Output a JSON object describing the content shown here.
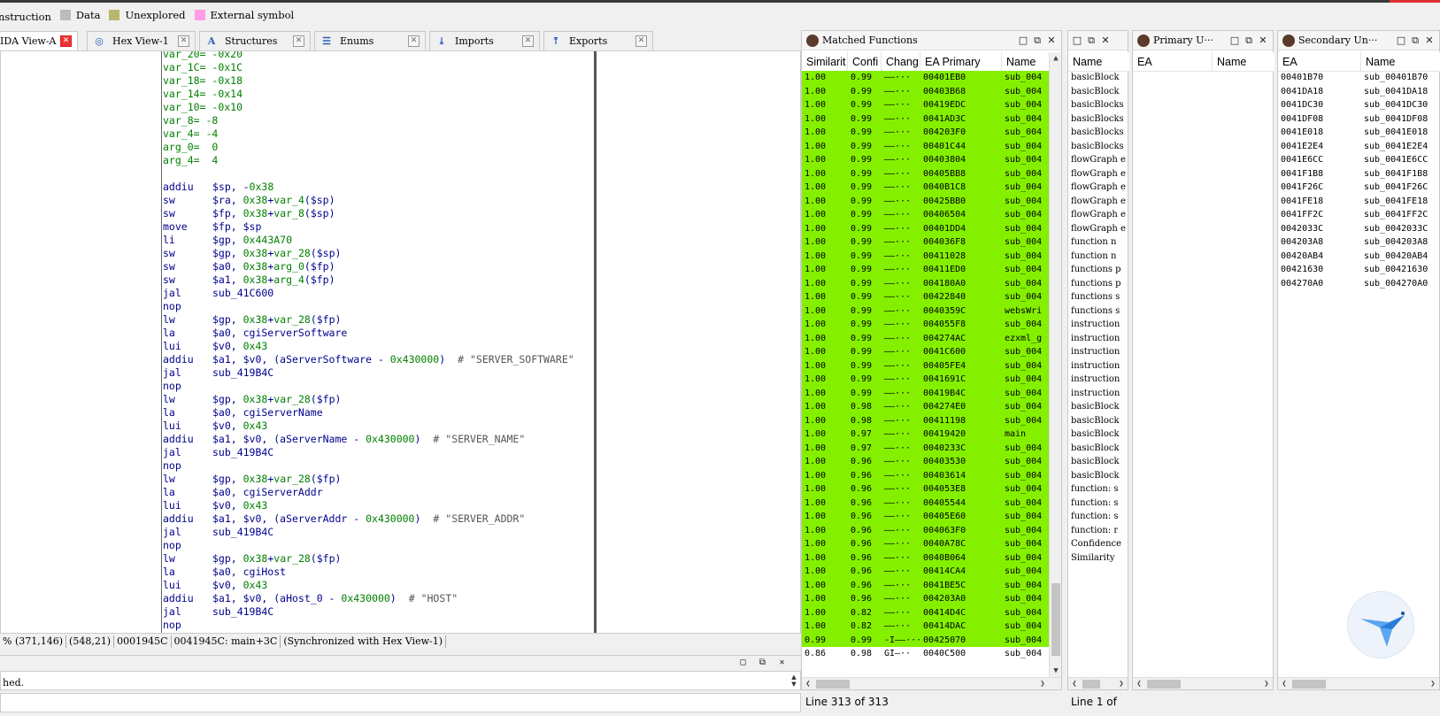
{
  "top_legend": [
    {
      "label": "nstruction",
      "color": ""
    },
    {
      "label": "Data",
      "color": "#bcbcbc"
    },
    {
      "label": "Unexplored",
      "color": "#b9b66e"
    },
    {
      "label": "External symbol",
      "color": "#ff9ce6"
    }
  ],
  "tabs": [
    {
      "label": "IDA View-A",
      "icon": "ida-view-icon",
      "active": true
    },
    {
      "label": "Hex View-1",
      "icon": "hex-view-icon",
      "active": false
    },
    {
      "label": "Structures",
      "icon": "structures-icon",
      "active": false
    },
    {
      "label": "Enums",
      "icon": "enums-icon",
      "active": false
    },
    {
      "label": "Imports",
      "icon": "imports-icon",
      "active": false
    },
    {
      "label": "Exports",
      "icon": "exports-icon",
      "active": false
    }
  ],
  "disasm_lines": [
    {
      "t": "var",
      "name": "var_20",
      "val": "-0x20"
    },
    {
      "t": "var",
      "name": "var_1C",
      "val": "-0x1C"
    },
    {
      "t": "var",
      "name": "var_18",
      "val": "-0x18"
    },
    {
      "t": "var",
      "name": "var_14",
      "val": "-0x14"
    },
    {
      "t": "var",
      "name": "var_10",
      "val": "-0x10"
    },
    {
      "t": "var",
      "name": "var_8",
      "val": "-8"
    },
    {
      "t": "var",
      "name": "var_4",
      "val": "-4"
    },
    {
      "t": "var",
      "name": "arg_0",
      "val": " 0"
    },
    {
      "t": "var",
      "name": "arg_4",
      "val": " 4"
    },
    {
      "t": "blank"
    },
    {
      "t": "ins",
      "m": "addiu",
      "ops": "$sp, -0x38"
    },
    {
      "t": "ins",
      "m": "sw",
      "ops": "$ra, 0x38+var_4($sp)"
    },
    {
      "t": "ins",
      "m": "sw",
      "ops": "$fp, 0x38+var_8($sp)"
    },
    {
      "t": "ins",
      "m": "move",
      "ops": "$fp, $sp"
    },
    {
      "t": "ins",
      "m": "li",
      "ops": "$gp, 0x443A70"
    },
    {
      "t": "ins",
      "m": "sw",
      "ops": "$gp, 0x38+var_28($sp)"
    },
    {
      "t": "ins",
      "m": "sw",
      "ops": "$a0, 0x38+arg_0($fp)"
    },
    {
      "t": "ins",
      "m": "sw",
      "ops": "$a1, 0x38+arg_4($fp)"
    },
    {
      "t": "ins",
      "m": "jal",
      "ops": "sub_41C600"
    },
    {
      "t": "ins",
      "m": "nop",
      "ops": ""
    },
    {
      "t": "ins",
      "m": "lw",
      "ops": "$gp, 0x38+var_28($fp)"
    },
    {
      "t": "ins",
      "m": "la",
      "ops": "$a0, cgiServerSoftware"
    },
    {
      "t": "ins",
      "m": "lui",
      "ops": "$v0, 0x43"
    },
    {
      "t": "ins",
      "m": "addiu",
      "ops": "$a1, $v0, (aServerSoftware - 0x430000)",
      "c": "# \"SERVER_SOFTWARE\""
    },
    {
      "t": "ins",
      "m": "jal",
      "ops": "sub_419B4C"
    },
    {
      "t": "ins",
      "m": "nop",
      "ops": ""
    },
    {
      "t": "ins",
      "m": "lw",
      "ops": "$gp, 0x38+var_28($fp)"
    },
    {
      "t": "ins",
      "m": "la",
      "ops": "$a0, cgiServerName"
    },
    {
      "t": "ins",
      "m": "lui",
      "ops": "$v0, 0x43"
    },
    {
      "t": "ins",
      "m": "addiu",
      "ops": "$a1, $v0, (aServerName - 0x430000)",
      "c": "# \"SERVER_NAME\""
    },
    {
      "t": "ins",
      "m": "jal",
      "ops": "sub_419B4C"
    },
    {
      "t": "ins",
      "m": "nop",
      "ops": ""
    },
    {
      "t": "ins",
      "m": "lw",
      "ops": "$gp, 0x38+var_28($fp)"
    },
    {
      "t": "ins",
      "m": "la",
      "ops": "$a0, cgiServerAddr"
    },
    {
      "t": "ins",
      "m": "lui",
      "ops": "$v0, 0x43"
    },
    {
      "t": "ins",
      "m": "addiu",
      "ops": "$a1, $v0, (aServerAddr - 0x430000)",
      "c": "# \"SERVER_ADDR\""
    },
    {
      "t": "ins",
      "m": "jal",
      "ops": "sub_419B4C"
    },
    {
      "t": "ins",
      "m": "nop",
      "ops": ""
    },
    {
      "t": "ins",
      "m": "lw",
      "ops": "$gp, 0x38+var_28($fp)"
    },
    {
      "t": "ins",
      "m": "la",
      "ops": "$a0, cgiHost"
    },
    {
      "t": "ins",
      "m": "lui",
      "ops": "$v0, 0x43"
    },
    {
      "t": "ins",
      "m": "addiu",
      "ops": "$a1, $v0, (aHost_0 - 0x430000)",
      "c": "# \"HOST\""
    },
    {
      "t": "ins",
      "m": "jal",
      "ops": "sub_419B4C"
    },
    {
      "t": "ins",
      "m": "nop",
      "ops": ""
    }
  ],
  "statusbar": [
    "% (371,146)",
    "(548,21)",
    "0001945C",
    "0041945C: main+3C",
    "(Synchronized with Hex View-1)"
  ],
  "output": {
    "text": "hed."
  },
  "matched": {
    "title": "Matched Functions",
    "columns": [
      "Similarit",
      "Confi",
      "Chang",
      "EA Primary",
      "Name"
    ],
    "rows": [
      [
        "1.00",
        "0.99",
        "——···",
        "00401EB0",
        "sub_004"
      ],
      [
        "1.00",
        "0.99",
        "——···",
        "00403B68",
        "sub_004"
      ],
      [
        "1.00",
        "0.99",
        "——···",
        "00419EDC",
        "sub_004"
      ],
      [
        "1.00",
        "0.99",
        "——···",
        "0041AD3C",
        "sub_004"
      ],
      [
        "1.00",
        "0.99",
        "——···",
        "004203F0",
        "sub_004"
      ],
      [
        "1.00",
        "0.99",
        "——···",
        "00401C44",
        "sub_004"
      ],
      [
        "1.00",
        "0.99",
        "——···",
        "00403804",
        "sub_004"
      ],
      [
        "1.00",
        "0.99",
        "——···",
        "00405BB8",
        "sub_004"
      ],
      [
        "1.00",
        "0.99",
        "——···",
        "0040B1C8",
        "sub_004"
      ],
      [
        "1.00",
        "0.99",
        "——···",
        "00425BB0",
        "sub_004"
      ],
      [
        "1.00",
        "0.99",
        "——···",
        "00406504",
        "sub_004"
      ],
      [
        "1.00",
        "0.99",
        "——···",
        "00401DD4",
        "sub_004"
      ],
      [
        "1.00",
        "0.99",
        "——···",
        "004036F8",
        "sub_004"
      ],
      [
        "1.00",
        "0.99",
        "——···",
        "00411028",
        "sub_004"
      ],
      [
        "1.00",
        "0.99",
        "——···",
        "00411ED0",
        "sub_004"
      ],
      [
        "1.00",
        "0.99",
        "——···",
        "004180A0",
        "sub_004"
      ],
      [
        "1.00",
        "0.99",
        "——···",
        "00422840",
        "sub_004"
      ],
      [
        "1.00",
        "0.99",
        "——···",
        "0040359C",
        "websWri"
      ],
      [
        "1.00",
        "0.99",
        "——···",
        "004055F8",
        "sub_004"
      ],
      [
        "1.00",
        "0.99",
        "——···",
        "004274AC",
        "ezxml_g"
      ],
      [
        "1.00",
        "0.99",
        "——···",
        "0041C600",
        "sub_004"
      ],
      [
        "1.00",
        "0.99",
        "——···",
        "00405FE4",
        "sub_004"
      ],
      [
        "1.00",
        "0.99",
        "——···",
        "0041691C",
        "sub_004"
      ],
      [
        "1.00",
        "0.99",
        "——···",
        "00419B4C",
        "sub_004"
      ],
      [
        "1.00",
        "0.98",
        "——···",
        "004274E0",
        "sub_004"
      ],
      [
        "1.00",
        "0.98",
        "——···",
        "00411198",
        "sub_004"
      ],
      [
        "1.00",
        "0.97",
        "——···",
        "00419420",
        "main"
      ],
      [
        "1.00",
        "0.97",
        "——···",
        "0040233C",
        "sub_004"
      ],
      [
        "1.00",
        "0.96",
        "——···",
        "00403530",
        "sub_004"
      ],
      [
        "1.00",
        "0.96",
        "——···",
        "00403614",
        "sub_004"
      ],
      [
        "1.00",
        "0.96",
        "——···",
        "004053E8",
        "sub_004"
      ],
      [
        "1.00",
        "0.96",
        "——···",
        "00405544",
        "sub_004"
      ],
      [
        "1.00",
        "0.96",
        "——···",
        "00405E60",
        "sub_004"
      ],
      [
        "1.00",
        "0.96",
        "——···",
        "004063F0",
        "sub_004"
      ],
      [
        "1.00",
        "0.96",
        "——···",
        "0040A78C",
        "sub_004"
      ],
      [
        "1.00",
        "0.96",
        "——···",
        "0040B064",
        "sub_004"
      ],
      [
        "1.00",
        "0.96",
        "——···",
        "00414CA4",
        "sub_004"
      ],
      [
        "1.00",
        "0.96",
        "——···",
        "0041BE5C",
        "sub_004"
      ],
      [
        "1.00",
        "0.96",
        "——···",
        "004203A0",
        "sub_004"
      ],
      [
        "1.00",
        "0.82",
        "——···",
        "00414D4C",
        "sub_004"
      ],
      [
        "1.00",
        "0.82",
        "——···",
        "00414DAC",
        "sub_004"
      ],
      [
        "0.99",
        "0.99",
        "-I——···",
        "00425070",
        "sub_004"
      ],
      [
        "0.86",
        "0.98",
        "GI—··",
        "0040C500",
        "sub_004"
      ]
    ],
    "row_colors": {
      "green": "#84f000",
      "white": "#ffffff"
    },
    "status": "Line 313 of 313"
  },
  "stats_panel": {
    "columns": [
      "Name"
    ],
    "rows": [
      "basicBlock",
      "basicBlock",
      "basicBlocks",
      "basicBlocks",
      "basicBlocks",
      "basicBlocks",
      "flowGraph e",
      "flowGraph e",
      "flowGraph e",
      "flowGraph e",
      "flowGraph e",
      "flowGraph e",
      "function n",
      "function n",
      "functions p",
      "functions p",
      "functions s",
      "functions s",
      "instruction",
      "instruction",
      "instruction",
      "instruction",
      "instruction",
      "instruction",
      "basicBlock",
      "basicBlock",
      "basicBlock",
      "basicBlock",
      "basicBlock",
      "basicBlock",
      "function: s",
      "function: s",
      "function: s",
      "function: r",
      "Confidence",
      "Similarity"
    ],
    "status": "Line 1 of"
  },
  "primary": {
    "title": "Primary U···",
    "columns": [
      "EA",
      "Name"
    ]
  },
  "secondary": {
    "title": "Secondary Un···",
    "columns": [
      "EA",
      "Name"
    ],
    "rows": [
      [
        "00401B70",
        "sub_00401B70"
      ],
      [
        "0041DA18",
        "sub_0041DA18"
      ],
      [
        "0041DC30",
        "sub_0041DC30"
      ],
      [
        "0041DF08",
        "sub_0041DF08"
      ],
      [
        "0041E018",
        "sub_0041E018"
      ],
      [
        "0041E2E4",
        "sub_0041E2E4"
      ],
      [
        "0041E6CC",
        "sub_0041E6CC"
      ],
      [
        "0041F1B8",
        "sub_0041F1B8"
      ],
      [
        "0041F26C",
        "sub_0041F26C"
      ],
      [
        "0041FE18",
        "sub_0041FE18"
      ],
      [
        "0041FF2C",
        "sub_0041FF2C"
      ],
      [
        "0042033C",
        "sub_0042033C"
      ],
      [
        "004203A8",
        "sub_004203A8"
      ],
      [
        "00420AB4",
        "sub_00420AB4"
      ],
      [
        "00421630",
        "sub_00421630"
      ],
      [
        "004270A0",
        "sub_004270A0"
      ]
    ]
  },
  "window_buttons": {
    "minimize": "□",
    "restore": "⧉",
    "close": "✕"
  }
}
